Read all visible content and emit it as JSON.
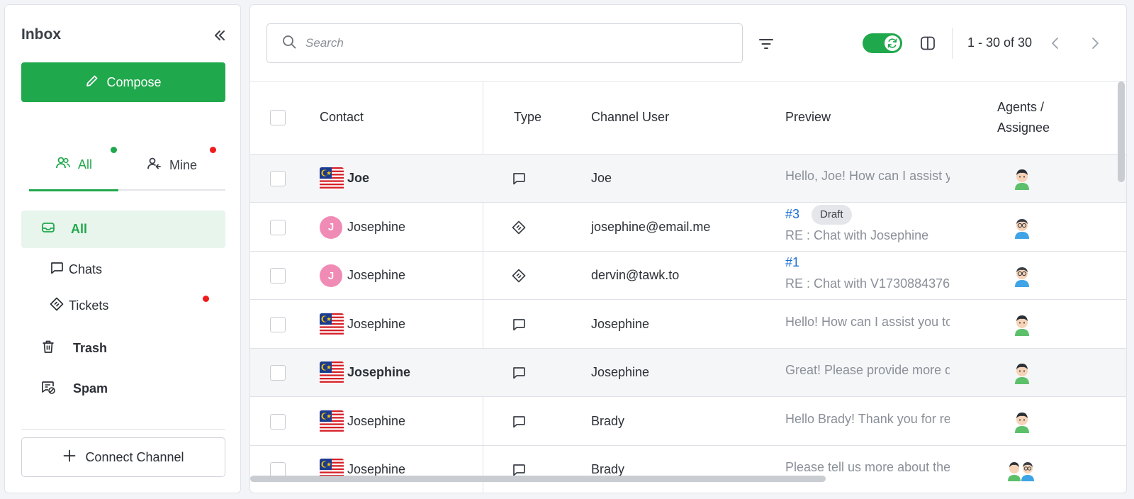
{
  "sidebar": {
    "title": "Inbox",
    "compose_label": "Compose",
    "tabs": [
      {
        "label": "All",
        "dot_color": "#20a84c"
      },
      {
        "label": "Mine",
        "dot_color": "#f01b1b"
      }
    ],
    "nav": {
      "all": "All",
      "chats": "Chats",
      "tickets": "Tickets",
      "trash": "Trash",
      "spam": "Spam"
    },
    "connect_label": "Connect Channel"
  },
  "toolbar": {
    "search_placeholder": "Search",
    "pager_text": "1 - 30 of 30",
    "auto_refresh_on": true
  },
  "table": {
    "headers": {
      "contact": "Contact",
      "type": "Type",
      "channel_user": "Channel User",
      "preview": "Preview",
      "agents_line1": "Agents /",
      "agents_line2": "Assignee"
    },
    "rows": [
      {
        "contact": "Joe",
        "contact_avatar": "malaysia-flag",
        "type": "chat",
        "channel_user": "Joe",
        "preview": "Hello, Joe! How can I assist you today?",
        "unread": true,
        "agent": "agent-male-green"
      },
      {
        "contact": "Josephine",
        "contact_avatar": "J",
        "type": "ticket",
        "channel_user": "josephine@email.me",
        "ticket_no": "#3",
        "badge": "Draft",
        "preview": "RE : Chat with Josephine",
        "unread": false,
        "agent": "agent-glasses-blue"
      },
      {
        "contact": "Josephine",
        "contact_avatar": "J",
        "type": "ticket",
        "channel_user": "dervin@tawk.to",
        "ticket_no": "#1",
        "preview": "RE : Chat with V1730884376",
        "unread": false,
        "agent": "agent-glasses-blue"
      },
      {
        "contact": "Josephine",
        "contact_avatar": "malaysia-flag",
        "type": "chat",
        "channel_user": "Josephine",
        "preview": "Hello! How can I assist you today?",
        "unread": false,
        "agent": "agent-male-green"
      },
      {
        "contact": "Josephine",
        "contact_avatar": "malaysia-flag",
        "type": "chat",
        "channel_user": "Josephine",
        "preview": "Great! Please provide more details",
        "unread": true,
        "agent": "agent-male-green"
      },
      {
        "contact": "Josephine",
        "contact_avatar": "malaysia-flag",
        "type": "chat",
        "channel_user": "Brady",
        "preview": "Hello Brady! Thank you for reaching out",
        "unread": false,
        "agent": "agent-male-green"
      },
      {
        "contact": "Josephine",
        "contact_avatar": "malaysia-flag",
        "type": "chat",
        "channel_user": "Brady",
        "preview": "Please tell us more about the issue",
        "unread": false,
        "agent": "agent-pair"
      }
    ]
  },
  "colors": {
    "accent": "#20a84c",
    "unread_dot": "#f01b1b",
    "link": "#1b6ed6",
    "muted_text": "#8a8f98"
  }
}
